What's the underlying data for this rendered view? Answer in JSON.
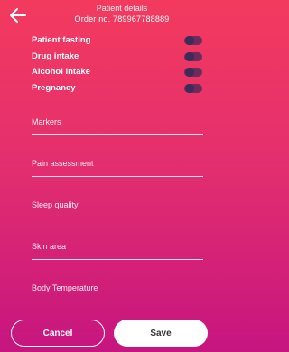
{
  "header": {
    "title": "Patient details",
    "order": "Order no. 789967788889",
    "back_icon": "arrow-left-icon"
  },
  "toggles": [
    {
      "label": "Patient fasting",
      "on": false
    },
    {
      "label": "Drug intake",
      "on": false
    },
    {
      "label": "Alcohol intake",
      "on": false
    },
    {
      "label": "Pregnancy",
      "on": false
    }
  ],
  "fields": [
    {
      "label": "Markers"
    },
    {
      "label": "Pain assessment"
    },
    {
      "label": "Sleep quality"
    },
    {
      "label": "Skin area"
    },
    {
      "label": "Body Temperature"
    }
  ],
  "footer": {
    "cancel_label": "Cancel",
    "save_label": "Save"
  },
  "colors": {
    "gradient_top": "#f33a5e",
    "gradient_bottom": "#c6157f",
    "switch_track": "#6a2c5a",
    "switch_knob": "#3d2b59"
  }
}
